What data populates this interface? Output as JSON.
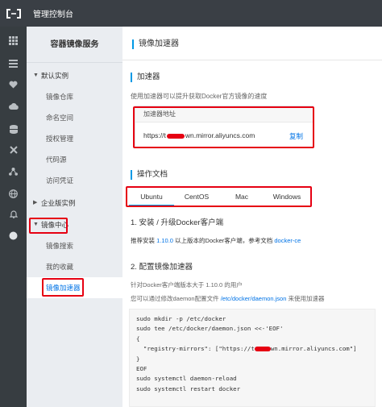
{
  "topbar": {
    "title": "管理控制台"
  },
  "sidebar": {
    "title": "容器镜像服务",
    "groups": [
      {
        "label": "默认实例",
        "caret": "▼",
        "items": [
          "镜像仓库",
          "命名空间",
          "授权管理",
          "代码源",
          "访问凭证"
        ]
      },
      {
        "label": "企业版实例",
        "caret": "▶",
        "items": []
      },
      {
        "label": "镜像中心",
        "caret": "▼",
        "items": [
          "镜像搜索",
          "我的收藏",
          "镜像加速器"
        ]
      }
    ],
    "active_item": "镜像加速器"
  },
  "main": {
    "page_title": "镜像加速器",
    "accelerator": {
      "heading": "加速器",
      "description": "使用加速器可以提升获取Docker官方镜像的速度",
      "box_label": "加速器地址",
      "url_prefix": "https://t",
      "url_suffix": "wn.mirror.aliyuncs.com",
      "copy_label": "复制"
    },
    "docs": {
      "heading": "操作文档",
      "tabs": [
        "Ubuntu",
        "CentOS",
        "Mac",
        "Windows"
      ],
      "active_tab": "Ubuntu",
      "step1": "1. 安装 / 升级Docker客户端",
      "step1_text_a": "推荐安装 ",
      "step1_version": "1.10.0",
      "step1_text_b": " 以上版本的Docker客户端，参考文档 ",
      "step1_link": "docker-ce",
      "step2": "2. 配置镜像加速器",
      "step2_line1": "针对Docker客户端版本大于 1.10.0 的用户",
      "step2_line2_a": "您可以通过修改daemon配置文件 ",
      "step2_line2_path": "/etc/docker/daemon.json",
      "step2_line2_b": " 来使用加速器",
      "code_lines": [
        "sudo mkdir -p /etc/docker",
        "sudo tee /etc/docker/daemon.json <<-'EOF'",
        "{",
        "  \"registry-mirrors\": [\"https://t",
        "wn.mirror.aliyuncs.com\"]",
        "}",
        "EOF",
        "sudo systemctl daemon-reload",
        "sudo systemctl restart docker"
      ]
    }
  },
  "colors": {
    "accent": "#0099e5",
    "link": "#0073e6",
    "annotation": "#e60012",
    "topbar": "#3a3f45",
    "rail": "#373d41",
    "sidebar": "#eaedf1"
  },
  "rail_icons": [
    "grid-icon",
    "list-icon",
    "heart-icon",
    "cloud-icon",
    "database-icon",
    "cross-icon",
    "network-icon",
    "globe-icon",
    "bell-icon",
    "circle-icon"
  ]
}
